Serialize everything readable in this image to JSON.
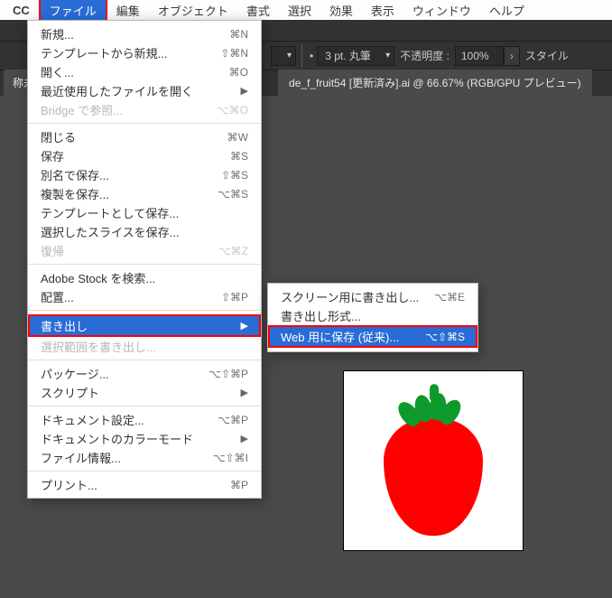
{
  "osmenu": {
    "cc": "CC",
    "items": [
      "ファイル",
      "編集",
      "オブジェクト",
      "書式",
      "選択",
      "効果",
      "表示",
      "ウィンドウ",
      "ヘルプ"
    ],
    "active_index": 0
  },
  "toolbar": {
    "left_crumb": "称未",
    "stroke_dd": "3 pt. 丸筆",
    "opacity_label": "不透明度 :",
    "opacity_value": "100%",
    "style_label": "スタイル"
  },
  "doc_tab": "de_f_fruit54 [更新済み].ai @ 66.67% (RGB/GPU プレビュー)",
  "file_menu": [
    {
      "label": "新規...",
      "sc": "⌘N"
    },
    {
      "label": "テンプレートから新規...",
      "sc": "⇧⌘N"
    },
    {
      "label": "開く...",
      "sc": "⌘O"
    },
    {
      "label": "最近使用したファイルを開く",
      "arrow": true
    },
    {
      "label": "Bridge で参照...",
      "sc": "⌥⌘O",
      "disabled": true
    },
    {
      "hr": true
    },
    {
      "label": "閉じる",
      "sc": "⌘W"
    },
    {
      "label": "保存",
      "sc": "⌘S"
    },
    {
      "label": "別名で保存...",
      "sc": "⇧⌘S"
    },
    {
      "label": "複製を保存...",
      "sc": "⌥⌘S"
    },
    {
      "label": "テンプレートとして保存..."
    },
    {
      "label": "選択したスライスを保存..."
    },
    {
      "label": "復帰",
      "sc": "⌥⌘Z",
      "disabled": true
    },
    {
      "hr": true
    },
    {
      "label": "Adobe Stock を検索..."
    },
    {
      "label": "配置...",
      "sc": "⇧⌘P"
    },
    {
      "hr": true
    },
    {
      "label": "書き出し",
      "arrow": true,
      "hi": true
    },
    {
      "label": "選択範囲を書き出し...",
      "disabled": true
    },
    {
      "hr": true
    },
    {
      "label": "パッケージ...",
      "sc": "⌥⇧⌘P"
    },
    {
      "label": "スクリプト",
      "arrow": true
    },
    {
      "hr": true
    },
    {
      "label": "ドキュメント設定...",
      "sc": "⌥⌘P"
    },
    {
      "label": "ドキュメントのカラーモード",
      "arrow": true
    },
    {
      "label": "ファイル情報...",
      "sc": "⌥⇧⌘I"
    },
    {
      "hr": true
    },
    {
      "label": "プリント...",
      "sc": "⌘P"
    }
  ],
  "export_submenu": [
    {
      "label": "スクリーン用に書き出し...",
      "sc": "⌥⌘E"
    },
    {
      "label": "書き出し形式..."
    },
    {
      "label": "Web 用に保存 (従来)...",
      "sc": "⌥⇧⌘S",
      "hi": true
    }
  ]
}
